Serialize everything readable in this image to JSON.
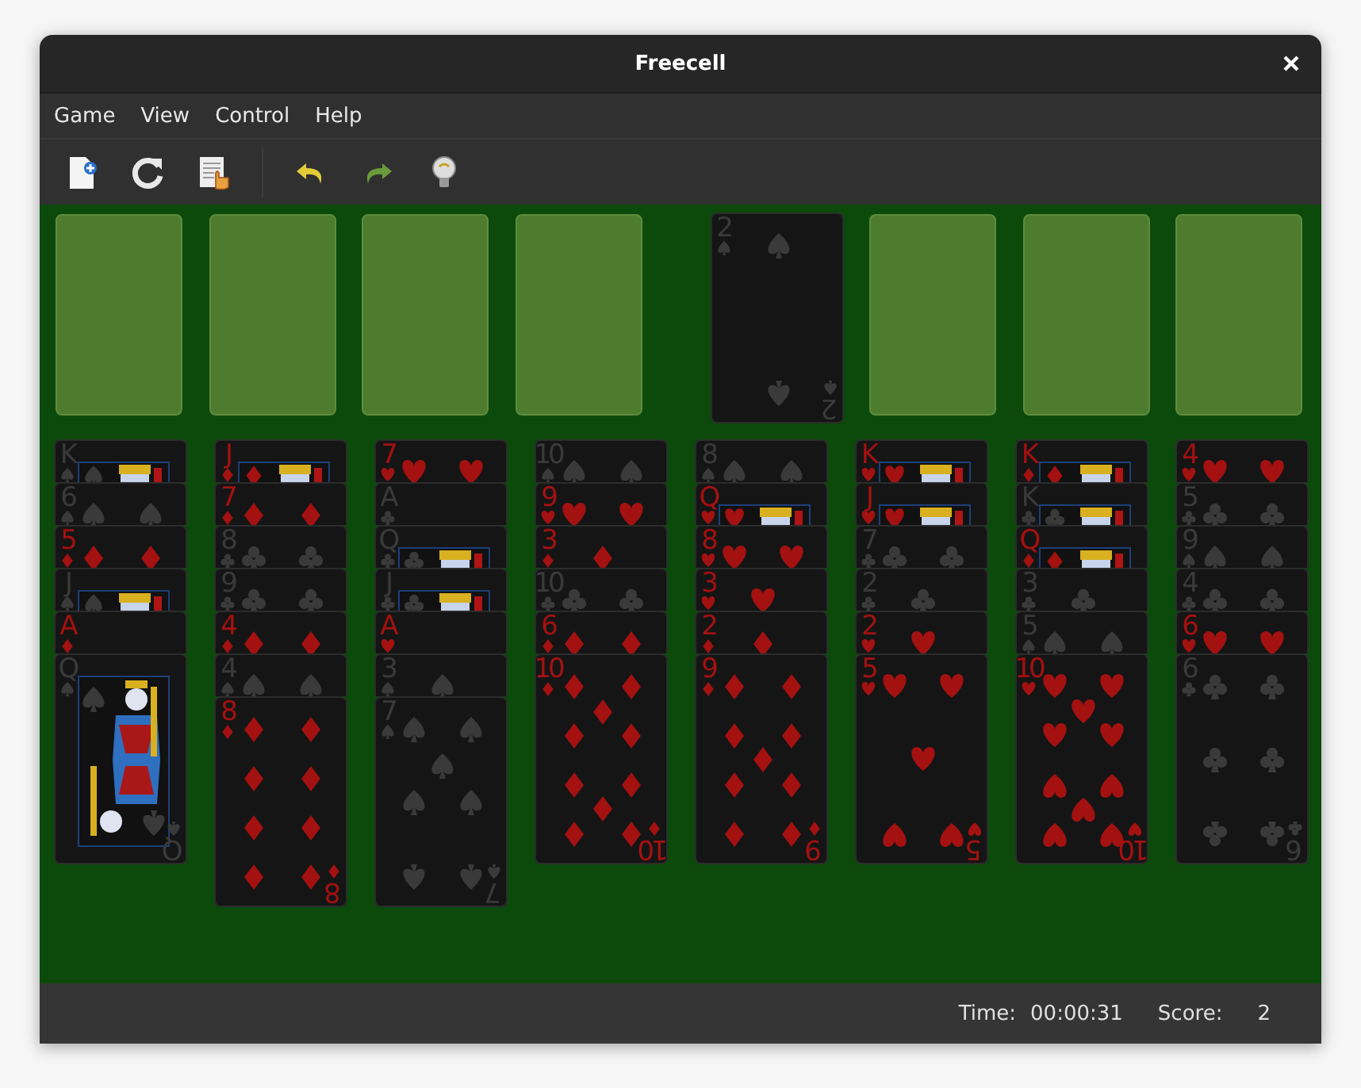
{
  "window": {
    "title": "Freecell"
  },
  "menu": [
    "Game",
    "View",
    "Control",
    "Help"
  ],
  "free_cells": [
    {
      "kind": "empty"
    },
    {
      "kind": "empty"
    },
    {
      "kind": "empty"
    },
    {
      "kind": "empty"
    }
  ],
  "foundations": [
    {
      "kind": "card",
      "card": {
        "rank": "2",
        "kind": "spades",
        "pips": {
          "kind": "two"
        },
        "corner_rank": "2"
      }
    },
    {
      "kind": "empty"
    },
    {
      "kind": "empty"
    },
    {
      "kind": "empty"
    }
  ],
  "tableau": [
    {
      "cards": [
        {
          "rank": "K",
          "kind": "spades",
          "pips": {
            "kind": "face"
          }
        },
        {
          "rank": "6",
          "kind": "spades",
          "pips": {
            "kind": "six"
          }
        },
        {
          "rank": "5",
          "kind": "diamonds",
          "pips": {
            "kind": "five"
          }
        },
        {
          "rank": "J",
          "kind": "spades",
          "pips": {
            "kind": "face"
          }
        },
        {
          "rank": "A",
          "kind": "diamonds",
          "pips": {
            "kind": "ace"
          }
        },
        {
          "rank": "Q",
          "kind": "spades",
          "pips": {
            "kind": "face"
          },
          "corner_rank": "Q"
        }
      ]
    },
    {
      "cards": [
        {
          "rank": "J",
          "kind": "diamonds",
          "pips": {
            "kind": "face"
          }
        },
        {
          "rank": "7",
          "kind": "diamonds",
          "pips": {
            "kind": "seven"
          }
        },
        {
          "rank": "8",
          "kind": "clubs",
          "pips": {
            "kind": "eight"
          }
        },
        {
          "rank": "9",
          "kind": "clubs",
          "pips": {
            "kind": "nine"
          }
        },
        {
          "rank": "4",
          "kind": "diamonds",
          "pips": {
            "kind": "four"
          }
        },
        {
          "rank": "4",
          "kind": "spades",
          "pips": {
            "kind": "four"
          }
        },
        {
          "rank": "8",
          "kind": "diamonds",
          "pips": {
            "kind": "eight"
          },
          "corner_rank": "8"
        }
      ]
    },
    {
      "cards": [
        {
          "rank": "7",
          "kind": "hearts",
          "pips": {
            "kind": "seven"
          }
        },
        {
          "rank": "A",
          "kind": "clubs",
          "pips": {
            "kind": "ace"
          }
        },
        {
          "rank": "Q",
          "kind": "clubs",
          "pips": {
            "kind": "face"
          }
        },
        {
          "rank": "J",
          "kind": "clubs",
          "pips": {
            "kind": "face"
          }
        },
        {
          "rank": "A",
          "kind": "hearts",
          "pips": {
            "kind": "ace"
          }
        },
        {
          "rank": "3",
          "kind": "spades",
          "pips": {
            "kind": "three"
          }
        },
        {
          "rank": "7",
          "kind": "spades",
          "pips": {
            "kind": "seven"
          },
          "corner_rank": "7"
        }
      ]
    },
    {
      "cards": [
        {
          "rank": "10",
          "kind": "spades",
          "pips": {
            "kind": "ten"
          }
        },
        {
          "rank": "9",
          "kind": "hearts",
          "pips": {
            "kind": "nine"
          }
        },
        {
          "rank": "3",
          "kind": "diamonds",
          "pips": {
            "kind": "three"
          }
        },
        {
          "rank": "10",
          "kind": "clubs",
          "pips": {
            "kind": "ten"
          }
        },
        {
          "rank": "6",
          "kind": "diamonds",
          "pips": {
            "kind": "six"
          }
        },
        {
          "rank": "10",
          "kind": "diamonds",
          "pips": {
            "kind": "ten"
          },
          "corner_rank": "10"
        }
      ]
    },
    {
      "cards": [
        {
          "rank": "8",
          "kind": "spades",
          "pips": {
            "kind": "eight"
          }
        },
        {
          "rank": "Q",
          "kind": "hearts",
          "pips": {
            "kind": "face"
          }
        },
        {
          "rank": "8",
          "kind": "hearts",
          "pips": {
            "kind": "eight"
          }
        },
        {
          "rank": "3",
          "kind": "hearts",
          "pips": {
            "kind": "three"
          }
        },
        {
          "rank": "2",
          "kind": "diamonds",
          "pips": {
            "kind": "two"
          }
        },
        {
          "rank": "9",
          "kind": "diamonds",
          "pips": {
            "kind": "nine"
          },
          "corner_rank": "9"
        }
      ]
    },
    {
      "cards": [
        {
          "rank": "K",
          "kind": "hearts",
          "pips": {
            "kind": "face"
          }
        },
        {
          "rank": "J",
          "kind": "hearts",
          "pips": {
            "kind": "face"
          }
        },
        {
          "rank": "7",
          "kind": "clubs",
          "pips": {
            "kind": "seven"
          }
        },
        {
          "rank": "2",
          "kind": "clubs",
          "pips": {
            "kind": "two"
          }
        },
        {
          "rank": "2",
          "kind": "hearts",
          "pips": {
            "kind": "two"
          }
        },
        {
          "rank": "5",
          "kind": "hearts",
          "pips": {
            "kind": "five"
          },
          "corner_rank": "5"
        }
      ]
    },
    {
      "cards": [
        {
          "rank": "K",
          "kind": "diamonds",
          "pips": {
            "kind": "face"
          }
        },
        {
          "rank": "K",
          "kind": "clubs",
          "pips": {
            "kind": "face"
          }
        },
        {
          "rank": "Q",
          "kind": "diamonds",
          "pips": {
            "kind": "face"
          }
        },
        {
          "rank": "3",
          "kind": "clubs",
          "pips": {
            "kind": "three"
          }
        },
        {
          "rank": "5",
          "kind": "spades",
          "pips": {
            "kind": "five"
          }
        },
        {
          "rank": "10",
          "kind": "hearts",
          "pips": {
            "kind": "ten"
          },
          "corner_rank": "10"
        }
      ]
    },
    {
      "cards": [
        {
          "rank": "4",
          "kind": "hearts",
          "pips": {
            "kind": "four"
          }
        },
        {
          "rank": "5",
          "kind": "clubs",
          "pips": {
            "kind": "five"
          }
        },
        {
          "rank": "9",
          "kind": "spades",
          "pips": {
            "kind": "nine"
          }
        },
        {
          "rank": "4",
          "kind": "clubs",
          "pips": {
            "kind": "four"
          }
        },
        {
          "rank": "6",
          "kind": "hearts",
          "pips": {
            "kind": "six"
          }
        },
        {
          "rank": "6",
          "kind": "clubs",
          "pips": {
            "kind": "six"
          },
          "corner_rank": "6"
        }
      ]
    }
  ],
  "status_bar": {
    "time_label": "Time:",
    "time": "00:00:31",
    "score_label": "Score:",
    "score": "2"
  }
}
